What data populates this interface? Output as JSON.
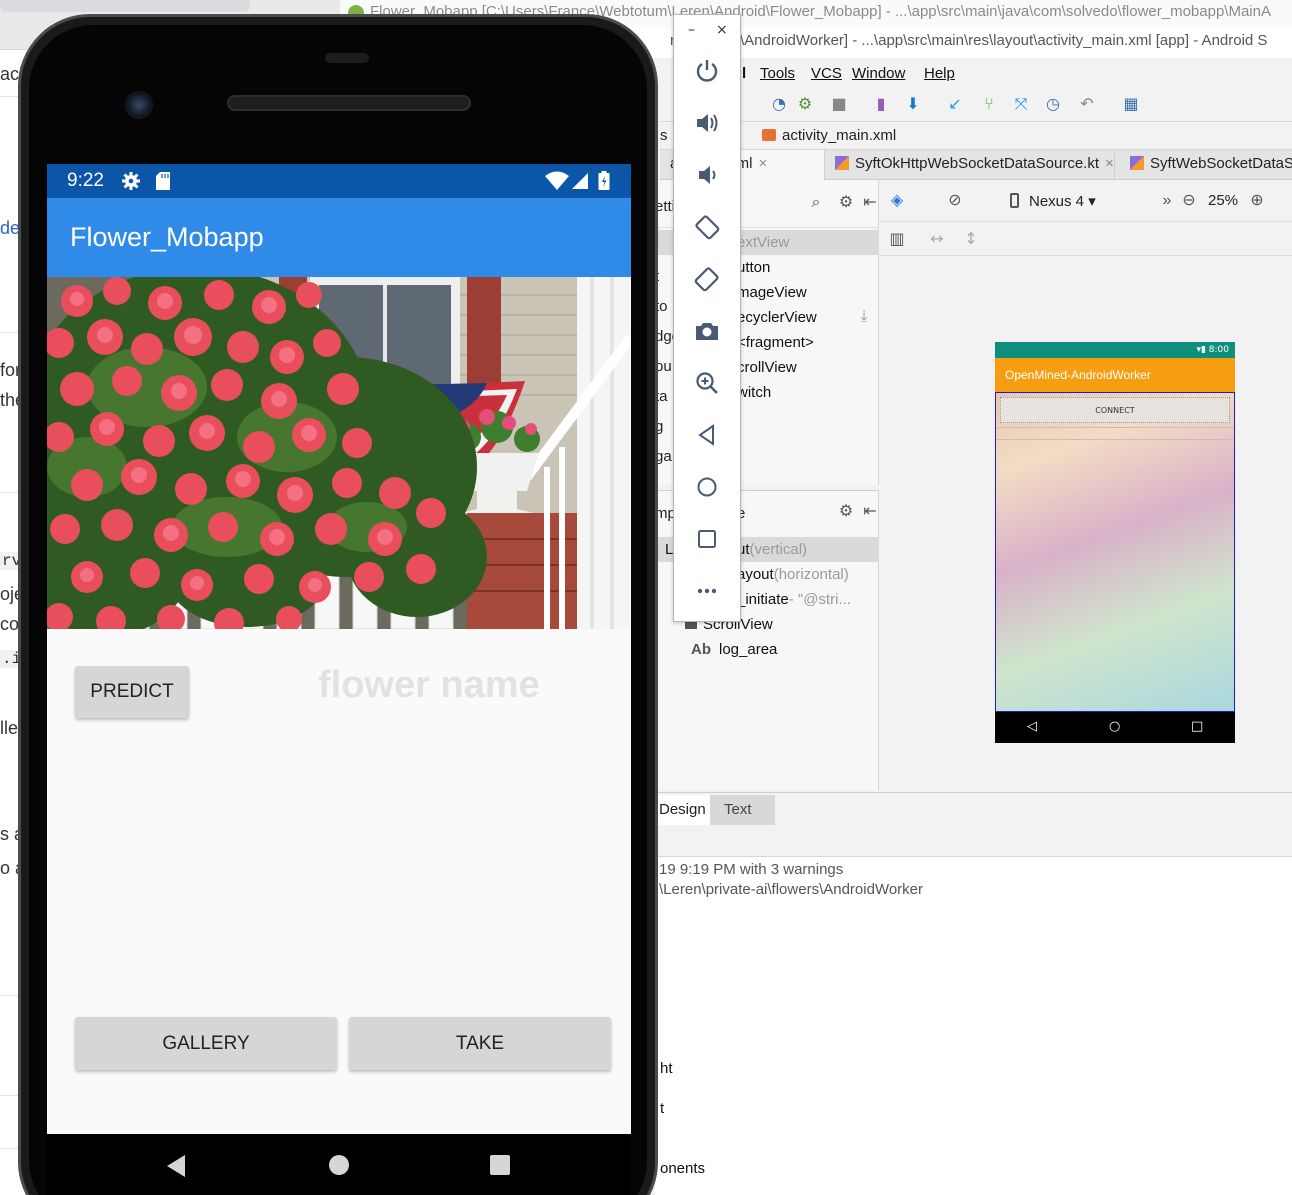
{
  "background_doc": {
    "fragments": [
      "aci",
      "de",
      "for",
      "the",
      "rv",
      "oje",
      "co",
      ".i",
      "lle",
      "s a",
      "o a"
    ]
  },
  "studio": {
    "title1": "Flower_Mobapp [C:\\Users\\France\\Webtotum\\Leren\\Android\\Flower_Mobapp] - ...\\app\\src\\main\\java\\com\\solvedo\\flower_mobapp\\MainA",
    "title2_prefix": "rivat",
    "title2": "\\AndroidWorker] - ...\\app\\src\\main\\res\\layout\\activity_main.xml [app] - Android S",
    "menu": [
      "Tools",
      "VCS",
      "Window",
      "Help"
    ],
    "breadcrumb": {
      "left1": "s",
      "left2": "t",
      "file": "activity_main.xml"
    },
    "tabs": [
      {
        "label": "a",
        "active": false
      },
      {
        "label": "ain.xml",
        "active": true
      },
      {
        "label": "SyftOkHttpWebSocketDataSource.kt",
        "active": false
      },
      {
        "label": "SyftWebSocketDataSou",
        "active": false
      }
    ],
    "palette": {
      "items": [
        "extView",
        "utton",
        "mageView",
        "ecyclerView",
        "<fragment>",
        "crollView",
        "witch"
      ],
      "side": [
        "etti",
        "mn",
        "t",
        "to",
        "dge",
        "ou",
        "ta",
        "g",
        "ga"
      ]
    },
    "tree": {
      "head": "mp",
      "head2": "e",
      "rows": [
        {
          "a": "L",
          "b": "ut",
          "c": "(vertical)"
        },
        {
          "a": "",
          "b": "ayout",
          "c": "(horizontal)"
        },
        {
          "a": "",
          "b": "_initiate",
          "c": "- \"@stri..."
        },
        {
          "a": "",
          "b": "ScrollView",
          "c": ""
        },
        {
          "a": "Ab",
          "b": "log_area",
          "c": ""
        }
      ]
    },
    "surface": {
      "device": "Nexus 4",
      "zoom": "25%"
    },
    "preview": {
      "time": "8:00",
      "app_title": "OpenMined-AndroidWorker",
      "button": "CONNECT"
    },
    "bottom_tabs": [
      "Design",
      "Text"
    ],
    "build": {
      "line1": "19 9:19 PM   with 3 warnings",
      "line2": "\\Leren\\private-ai\\flowers\\AndroidWorker"
    },
    "left_bottom": [
      "ht",
      "t",
      "onents"
    ]
  },
  "emulator_panel": {
    "minimize": "–",
    "close": "×",
    "buttons": [
      "power-icon",
      "volume-up-icon",
      "volume-down-icon",
      "rotate-left-icon",
      "rotate-right-icon",
      "camera-icon",
      "zoom-icon",
      "back-icon",
      "home-icon",
      "overview-icon",
      "more-icon"
    ]
  },
  "phone": {
    "status": {
      "time": "9:22"
    },
    "app_title": "Flower_Mobapp",
    "predict_label": "PREDICT",
    "flower_name_hint": "flower name",
    "gallery_label": "GALLERY",
    "take_label": "TAKE"
  },
  "colors": {
    "status_bar": "#0b56a8",
    "app_bar": "#2f8ae8",
    "button": "#d6d6d6",
    "preview_status": "#0e8f7b",
    "preview_appbar": "#f79d12"
  }
}
